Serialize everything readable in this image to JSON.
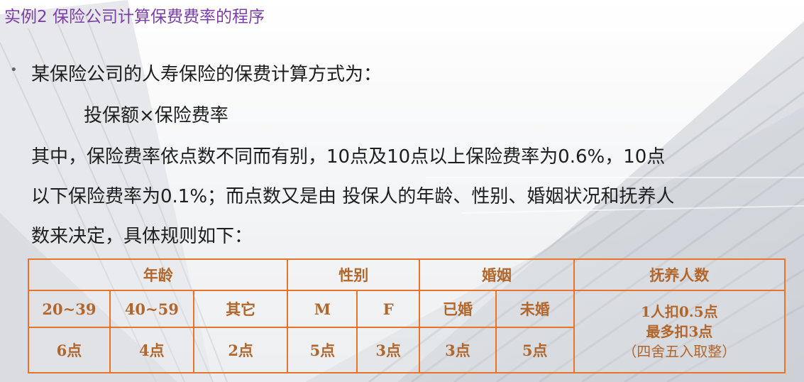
{
  "slide": {
    "title": "实例2 保险公司计算保费费率的程序",
    "bullet": "•",
    "line1": "某保险公司的人寿保险的保费计算方式为：",
    "formula": "投保额×保险费率",
    "line3": "其中，保险费率依点数不同而有别，10点及10点以上保险费率为0.6%，10点",
    "line4": "以下保险费率为0.1%；而点数又是由 投保人的年龄、性别、婚姻状况和抚养人",
    "line5": "数来决定，具体规则如下："
  },
  "table": {
    "headers": {
      "age": "年龄",
      "sex": "性别",
      "marriage": "婚姻",
      "dependents": "抚养人数"
    },
    "row1": [
      "20~39",
      "40~59",
      "其它",
      "M",
      "F",
      "已婚",
      "未婚"
    ],
    "row2": [
      "6点",
      "4点",
      "2点",
      "5点",
      "3点",
      "3点",
      "5点"
    ],
    "dependents_rule": [
      "1人扣0.5点",
      "最多扣3点",
      "（四舍五入取整）"
    ]
  },
  "colors": {
    "title": "#7b3fa8",
    "table_border": "#e8742a",
    "table_text": "#b2662c"
  }
}
